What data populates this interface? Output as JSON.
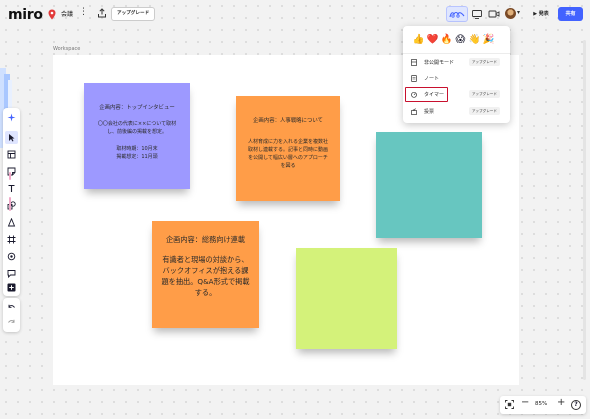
{
  "app": {
    "logo": "miro",
    "board_name": "会議",
    "more": "⋮",
    "upgrade_label": "アップグレード",
    "present_label": "▶ 発表",
    "share_label": "共有",
    "accent_color": "#4262ff"
  },
  "canvas": {
    "frame_label": "Workspace"
  },
  "stickies": [
    {
      "color": "#9d99ff",
      "title": "企画内容：トップインタビュー",
      "body": "〇〇会社の代表に××について取材し、前後編の掲載を想定。",
      "body2": "取材時期：10月末\n掲載想定：11月頭"
    },
    {
      "color": "#ff9d48",
      "title": "企画内容：人事戦略について",
      "body": "人材育成に力を入れる企業を複数社取材し連載する。記事と同時に動画を公開して幅広い層へのアプローチを図る"
    },
    {
      "color": "#ff9d48",
      "title": "企画内容：総務向け連載",
      "body": "有識者と現場の対談から、バックオフィスが抱える課題を抽出。Q&A形式で掲載する。"
    },
    {
      "color": "#67c6c0",
      "title": "",
      "body": ""
    },
    {
      "color": "#d4f27a",
      "title": "",
      "body": ""
    }
  ],
  "reactions_menu": {
    "emojis": [
      "👍",
      "❤️",
      "🔥",
      "😱",
      "👋",
      "🎉"
    ],
    "items": [
      {
        "label": "非公開モード",
        "badge": "アップグレード",
        "icon": "private-mode-icon"
      },
      {
        "label": "ノート",
        "badge": "",
        "icon": "note-icon"
      },
      {
        "label": "タイマー",
        "badge": "アップグレード",
        "icon": "timer-icon"
      },
      {
        "label": "投票",
        "badge": "アップグレード",
        "icon": "vote-icon"
      }
    ]
  },
  "zoom": {
    "level": "85%",
    "minus": "−",
    "plus": "+",
    "help": "?"
  }
}
